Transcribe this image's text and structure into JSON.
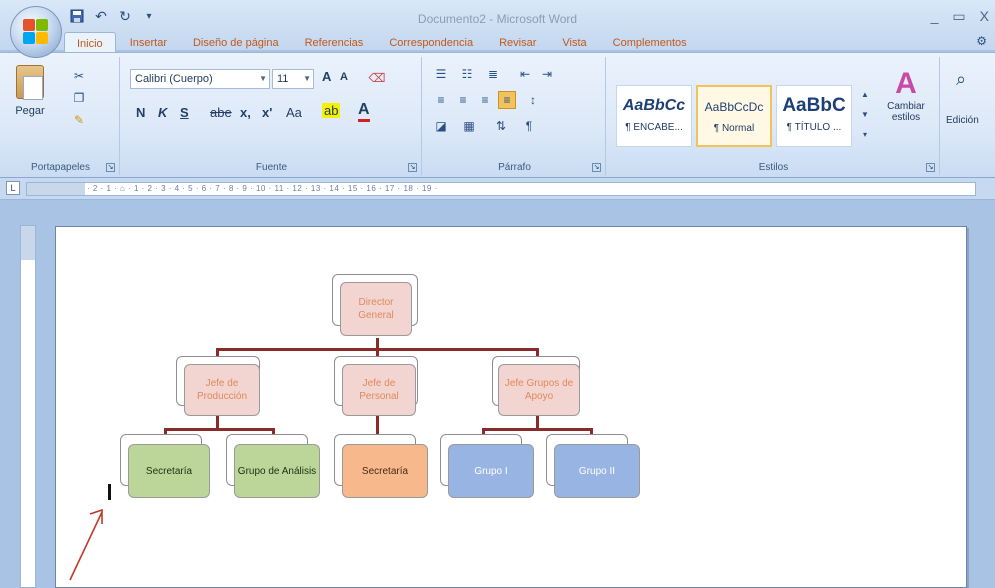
{
  "window": {
    "title": "Documento2 - Microsoft Word",
    "controls": [
      "_",
      "▭",
      "X"
    ]
  },
  "quick_access": {
    "icons": [
      "save-icon",
      "undo-icon",
      "redo-icon",
      "customize-icon"
    ]
  },
  "tabs": [
    {
      "label": "Inicio",
      "active": true
    },
    {
      "label": "Insertar"
    },
    {
      "label": "Diseño de página"
    },
    {
      "label": "Referencias"
    },
    {
      "label": "Correspondencia"
    },
    {
      "label": "Revisar"
    },
    {
      "label": "Vista"
    },
    {
      "label": "Complementos"
    }
  ],
  "ribbon": {
    "clipboard": {
      "label": "Portapapeles",
      "paste": "Pegar"
    },
    "font": {
      "label": "Fuente",
      "font_name": "Calibri (Cuerpo)",
      "font_size": "11",
      "grow": "A",
      "shrink": "A",
      "bold": "N",
      "italic": "K",
      "underline": "S",
      "strike": "abe",
      "subscript": "x,",
      "superscript": "x'",
      "case": "Aa",
      "highlight": "ab",
      "font_color": "A"
    },
    "paragraph": {
      "label": "Párrafo",
      "pilcrow": "¶"
    },
    "styles": {
      "label": "Estilos",
      "items": [
        {
          "sample": "AaBbCc",
          "name": "¶ ENCABE..."
        },
        {
          "sample": "AaBbCcDc",
          "name": "¶ Normal",
          "selected": true
        },
        {
          "sample": "AaBbC",
          "name": "¶ TÍTULO ..."
        }
      ],
      "change_styles": "Cambiar estilos"
    },
    "editing": {
      "label": "Edición"
    }
  },
  "ruler": {
    "marks": "· 2 · 1 · ⌂ · 1 · 2 · 3 · 4 · 5 · 6 · 7 · 8 · 9 · 10 · 11 · 12 · 13 · 14 · 15 · 16 · 17 · 18 · 19 ·",
    "corner_glyph": "L"
  },
  "org_chart": {
    "root": "Director General",
    "managers": [
      "Jefe de Producción",
      "Jefe de Personal",
      "Jefe Grupos de Apoyo"
    ],
    "staff": [
      "Secretaría",
      "Grupo de Análisis",
      "Secretaría",
      "Grupo I",
      "Grupo II"
    ],
    "colors": {
      "pink": "#f2d4d0",
      "green": "#bcd69a",
      "orange": "#f7b98b",
      "blue": "#98b4e2",
      "connector": "#8a2b2b"
    }
  }
}
